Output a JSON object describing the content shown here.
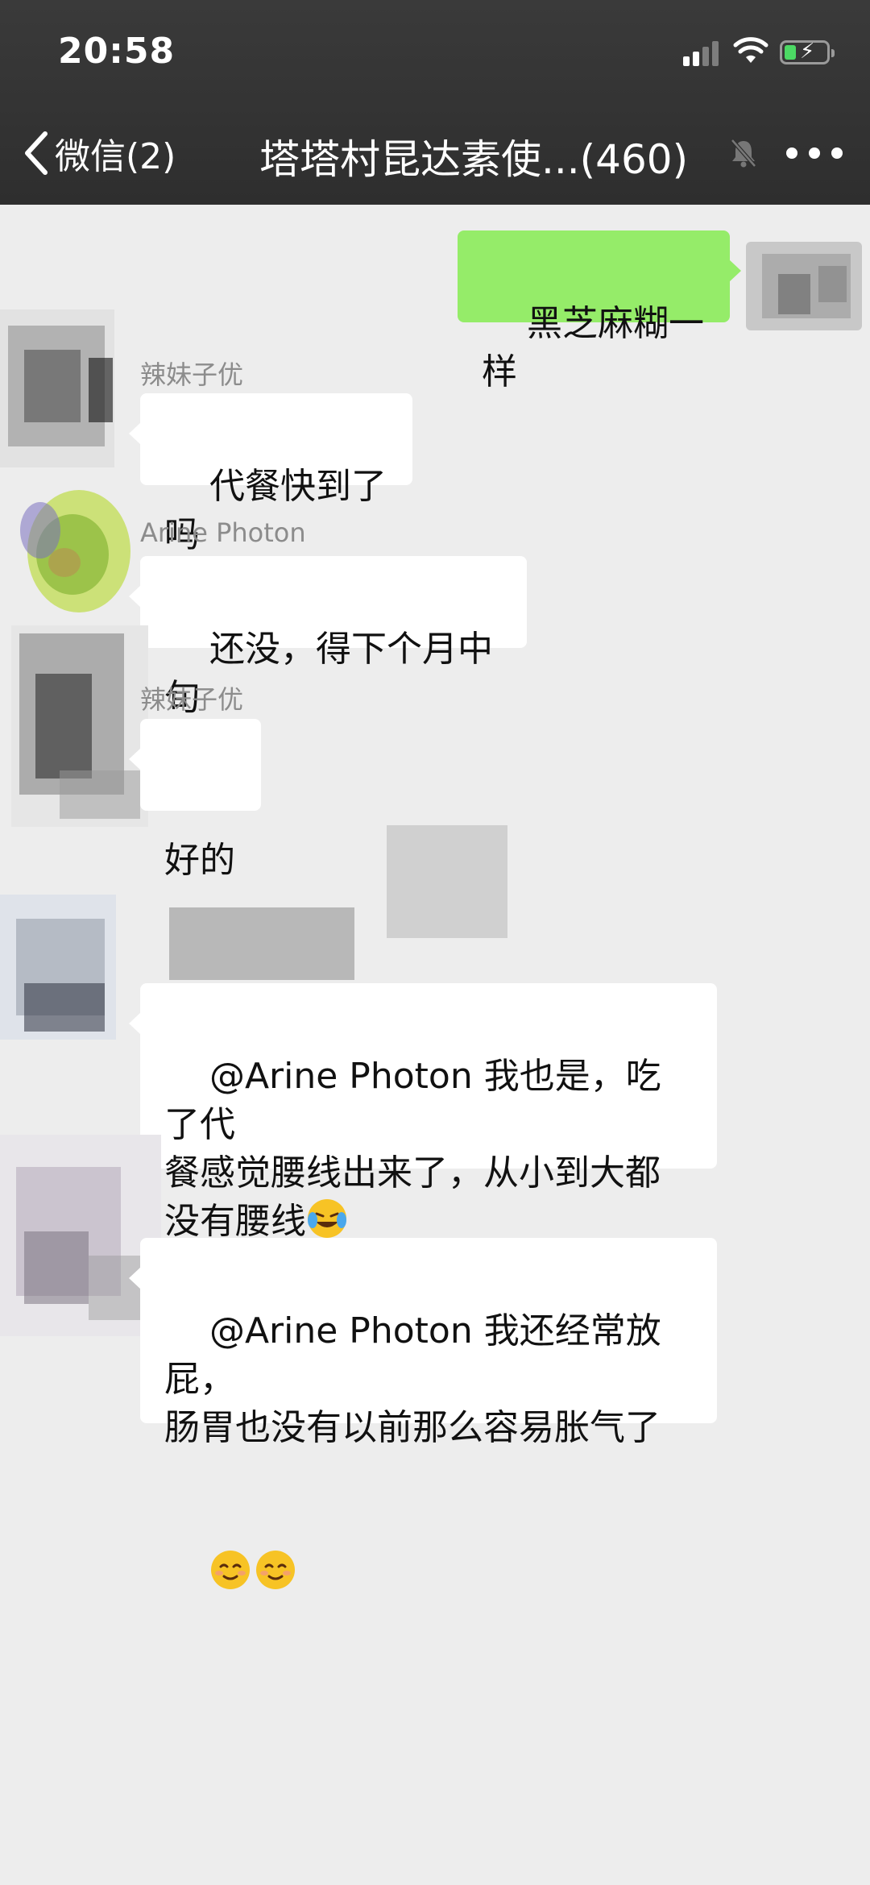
{
  "status_bar": {
    "time": "20:58"
  },
  "nav": {
    "back_label": "微信(2)",
    "title": "塔塔村昆达素使...(460)"
  },
  "messages": [
    {
      "side": "right",
      "sender": "",
      "text": "黑芝麻糊一样"
    },
    {
      "side": "left",
      "sender": "辣妹子优",
      "text": "代餐快到了吗"
    },
    {
      "side": "left",
      "sender": "Arine Photon",
      "text": "还没，得下个月中旬"
    },
    {
      "side": "left",
      "sender": "辣妹子优",
      "text": "好的"
    },
    {
      "side": "left",
      "sender": "",
      "text": "@Arine Photon 我也是，吃了代\n餐感觉腰线出来了，从小到大都\n没有腰线",
      "emojis": [
        "face-with-tears-icon"
      ]
    },
    {
      "side": "left",
      "sender": "",
      "text": "@Arine Photon 我还经常放屁，\n肠胃也没有以前那么容易胀气了",
      "emojis": [
        "smiling-face-icon",
        "smiling-face-icon"
      ]
    }
  ],
  "colors": {
    "nav_bg": "#2e2e2e",
    "chat_bg": "#ededed",
    "bubble_self": "#95ec69",
    "bubble_other": "#ffffff",
    "battery_fill": "#4cd964"
  }
}
